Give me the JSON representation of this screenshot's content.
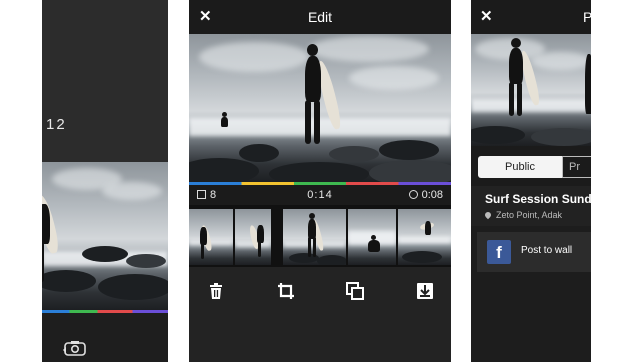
{
  "left_screen": {
    "counter": "12",
    "camera_icon": "camera-flip-icon"
  },
  "edit_screen": {
    "title": "Edit",
    "close_icon": "close-icon",
    "clip_count": "8",
    "timeline_time": "0:14",
    "selected_clip_duration": "0:08",
    "colorbar": [
      "#2b7fd8",
      "#f2c230",
      "#3fb950",
      "#e24b4b",
      "#6b4fd8"
    ],
    "thumbnails": [
      {
        "selected": false
      },
      {
        "selected": false
      },
      {
        "selected": true
      },
      {
        "selected": false
      },
      {
        "selected": false
      }
    ],
    "tools": [
      "trash-icon",
      "crop-icon",
      "duplicate-icon",
      "download-icon"
    ],
    "selection_color": "#36c9e8"
  },
  "post_screen": {
    "title_partial": "Pu",
    "visibility_options": [
      "Public",
      "Pr"
    ],
    "selected_visibility": "Public",
    "session_title": "Surf Session Sunday",
    "location": "Zeto Point, Adak",
    "post_button_label": "Post to wall",
    "facebook_color": "#3b5998"
  }
}
